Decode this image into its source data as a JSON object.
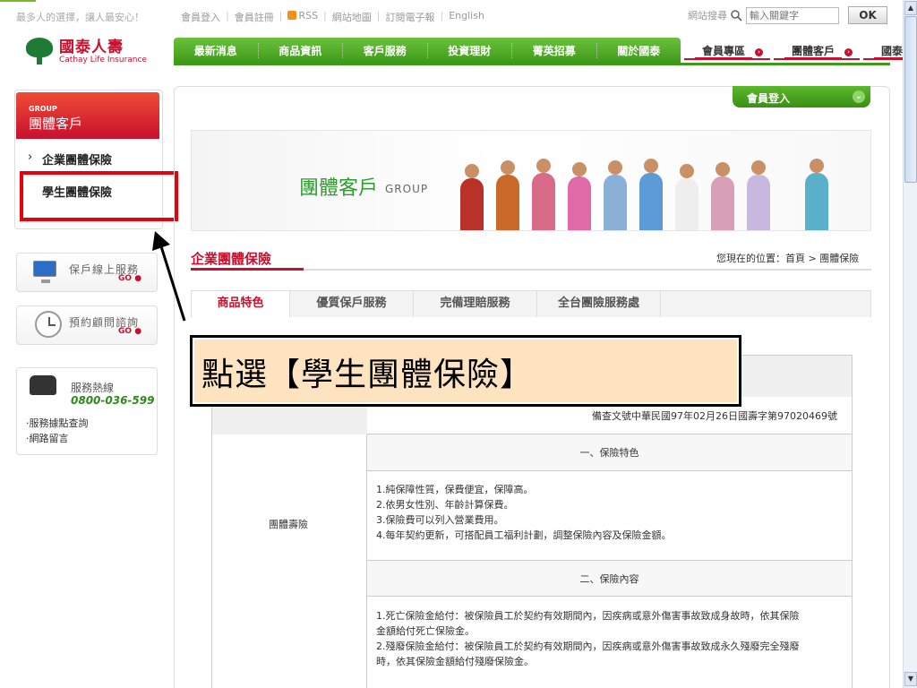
{
  "topbar": {
    "slogan": "最多人的選擇，讓人最安心！",
    "links": [
      "會員登入",
      "會員註冊",
      "RSS",
      "網站地圖",
      "訂閱電子報",
      "English"
    ],
    "search_label": "網站搜尋",
    "search_placeholder": "輸入關鍵字",
    "ok_label": "OK"
  },
  "logo": {
    "cn": "國泰人壽",
    "en": "Cathay Life Insurance"
  },
  "main_nav": [
    "最新消息",
    "商品資訊",
    "客戶服務",
    "投資理財",
    "菁英招募",
    "關於國泰"
  ],
  "right_nav": [
    "會員專區",
    "團體客戶",
    "國泰員工"
  ],
  "sidebar": {
    "group_en": "GROUP",
    "group_cn": "團體客戶",
    "items": [
      {
        "label": "企業團體保險"
      },
      {
        "label": "學生團體保險"
      }
    ],
    "online_service": "保戶線上服務",
    "appointment": "預約顧問諮詢",
    "go_label": "GO",
    "hotline_label": "服務熱線",
    "hotline_number": "0800-036-599",
    "links": [
      "‧服務據點查詢",
      "‧網路留言"
    ]
  },
  "member_login": "會員登入",
  "banner": {
    "title": "團體客戶",
    "sub": "GROUP"
  },
  "page_title": "企業團體保險",
  "breadcrumb": "您現在的位置：首頁 > 團體保險",
  "tabs": [
    "商品特色",
    "優質保戶服務",
    "完備理賠服務",
    "全台團險服務處"
  ],
  "table": {
    "product": "團體壽險",
    "approval": "備查文號中華民國97年02月26日國壽字第97020469號",
    "section1": "一、保險特色",
    "features": [
      "1.純保障性質，保費便宜，保障高。",
      "2.依男女性別、年齡計算保費。",
      "3.保險費可以列入營業費用。",
      "4.每年契約更新，可搭配員工福利計劃，調整保險內容及保險金額。"
    ],
    "section2": "二、保險內容",
    "contents": [
      "1.死亡保險金給付：被保險員工於契約有效期間內，因疾病或意外傷害事故致成身故時，依其保險",
      "金額給付死亡保險金。",
      "2.殘廢保險金給付：被保險員工於契約有效期間內，因疾病或意外傷害事故致成永久殘廢完全殘廢",
      "時，依其保險金額給付殘廢保險金。"
    ]
  },
  "callout": "點選【學生團體保險】",
  "colors": {
    "brand_red": "#c8102e",
    "nav_green": "#3e9a1a",
    "highlight_red": "#e8000b"
  }
}
